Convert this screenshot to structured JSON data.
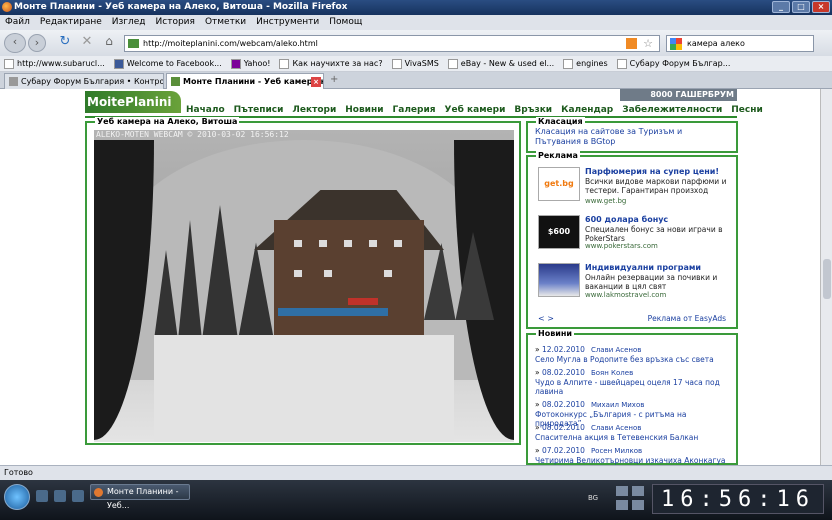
{
  "window": {
    "title": "Монте Планини - Уеб камера на Алеко, Витоша - Mozilla Firefox"
  },
  "menu": [
    "Файл",
    "Редактиране",
    "Изглед",
    "История",
    "Отметки",
    "Инструменти",
    "Помощ"
  ],
  "nav": {
    "url": "http://moiteplanini.com/webcam/aleko.html",
    "search_value": "камера алеко"
  },
  "bookmarks": [
    "http://www.subarucl...",
    "Welcome to Facebook...",
    "Yahoo!",
    "Как научихте за нас?",
    "VivaSMS",
    "eBay - New & used el...",
    "engines",
    "Субару Форум Българ..."
  ],
  "tabs": [
    {
      "label": "Субару Форум България • Контролен..."
    },
    {
      "label": "Монте Планини - Уеб камера на ..."
    }
  ],
  "site": {
    "logo": "MoitePlanini",
    "banner": "8000 ГАШЕРБРУМ",
    "nav": [
      "Начало",
      "Пътеписи",
      "Лектори",
      "Новини",
      "Галерия",
      "Уеб камери",
      "Връзки",
      "Календар",
      "Забележителности",
      "Песни"
    ]
  },
  "webcam": {
    "box_title": "Уеб камера на Алеко, Витоша",
    "timestamp": "ALEKO-MOTEN WEBCAM © 2010-03-02 16:56:12"
  },
  "ranking": {
    "title": "Класация",
    "link": "Класация на сайтове за Туризъм и Пътувания в BGtop"
  },
  "ads": {
    "title": "Реклама",
    "items": [
      {
        "title": "Парфюмерия на супер цени!",
        "text": "Всички видове маркови парфюми и тестери. Гарантиран произход",
        "url": "www.get.bg",
        "img_text": "get.bg"
      },
      {
        "title": "600 долара бонус",
        "text": "Специален бонус за нови играчи в PokerStars",
        "url": "www.pokerstars.com",
        "img_text": "$600 ПОКЕР"
      },
      {
        "title": "Индивидуални програми",
        "text": "Онлайн резервации за почивки и ваканции в цял свят",
        "url": "www.lakmostravel.com",
        "img_text": ""
      }
    ],
    "nav": "< >",
    "by": "Реклама от EasyAds"
  },
  "news": {
    "title": "Новини",
    "items": [
      {
        "date": "12.02.2010",
        "author": "Слави Асенов",
        "text": "Село Мугла в Родопите без връзка със света"
      },
      {
        "date": "08.02.2010",
        "author": "Боян Колев",
        "text": "Чудо в Алпите - швейцарец оцеля 17 часа под лавина"
      },
      {
        "date": "08.02.2010",
        "author": "Михаил Михов",
        "text": "Фотоконкурс „България - с ритъма на природата”"
      },
      {
        "date": "08.02.2010",
        "author": "Слави Асенов",
        "text": "Спасителна акция в Тетевенския Балкан"
      },
      {
        "date": "07.02.2010",
        "author": "Росен Милков",
        "text": "Четирима Великотърновци изкачиха Аконкагуа"
      }
    ]
  },
  "status": "Готово",
  "taskbar": {
    "window": "Монте Планини - Уеб...",
    "lang": "BG",
    "clock": "16:56:16"
  }
}
